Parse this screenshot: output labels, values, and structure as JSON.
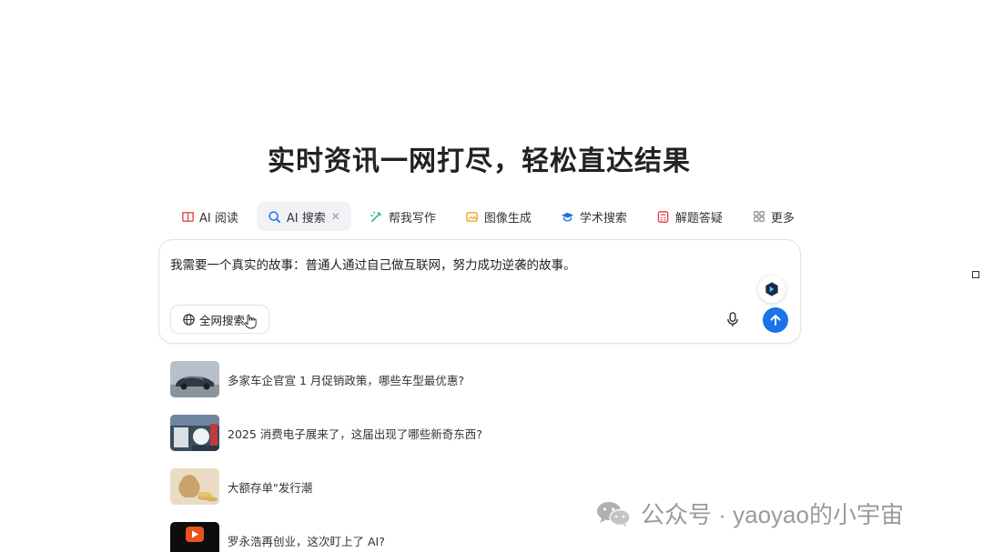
{
  "headline": "实时资讯一网打尽，轻松直达结果",
  "tabs": [
    {
      "label": "AI 阅读",
      "icon": "book-icon",
      "color": "#e5484d"
    },
    {
      "label": "AI 搜索",
      "icon": "ai-search-icon",
      "color": "#1a73e8"
    },
    {
      "label": "帮我写作",
      "icon": "pen-icon",
      "color": "#22b573"
    },
    {
      "label": "图像生成",
      "icon": "image-icon",
      "color": "#f5a623"
    },
    {
      "label": "学术搜索",
      "icon": "graduation-cap-icon",
      "color": "#1a73e8"
    },
    {
      "label": "解题答疑",
      "icon": "calculator-icon",
      "color": "#e5484d"
    },
    {
      "label": "更多",
      "icon": "grid-icon",
      "color": "#888888"
    }
  ],
  "search_box": {
    "query": "我需要一个真实的故事：普通人通过自己做互联网，努力成功逆袭的故事。",
    "scope_label": "全网搜索"
  },
  "news": [
    {
      "text": "多家车企官宣 1 月促销政策，哪些车型最优惠?"
    },
    {
      "text": "2025 消费电子展来了，这届出现了哪些新奇东西?"
    },
    {
      "text": "大额存单\"发行潮"
    },
    {
      "text": "罗永浩再创业，这次盯上了 AI?"
    }
  ],
  "watermark": "公众号 · yaoyao的小宇宙",
  "colors": {
    "accent": "#1a73e8",
    "active_tab_bg": "#f1f2f5"
  }
}
